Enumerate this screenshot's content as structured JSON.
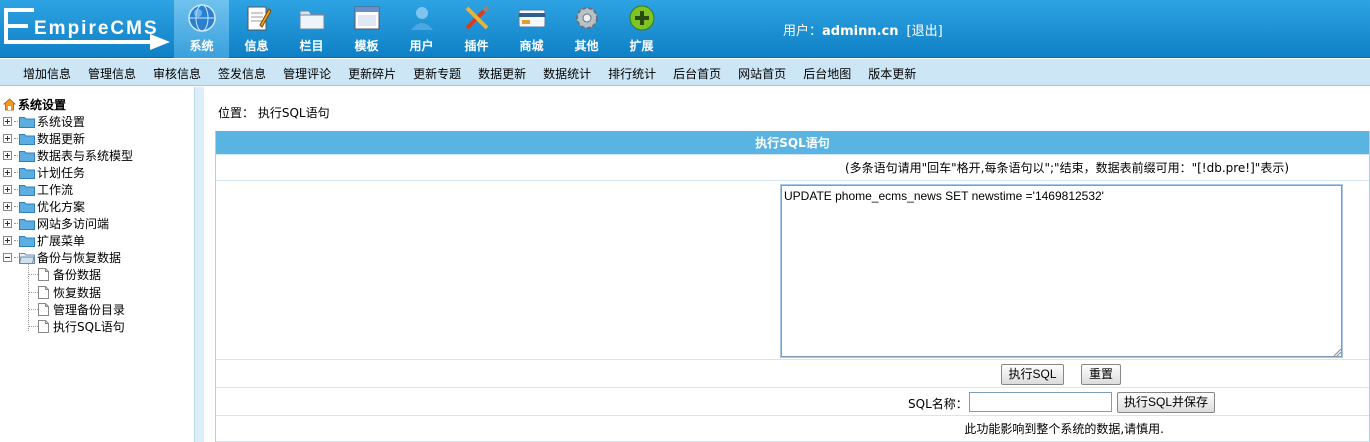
{
  "header": {
    "logo_text": "EmpireCMS",
    "nav": [
      {
        "label": "系统",
        "icon": "globe-icon",
        "active": true
      },
      {
        "label": "信息",
        "icon": "notepad-icon",
        "active": false
      },
      {
        "label": "栏目",
        "icon": "folder-icon",
        "active": false
      },
      {
        "label": "模板",
        "icon": "window-icon",
        "active": false
      },
      {
        "label": "用户",
        "icon": "user-icon",
        "active": false
      },
      {
        "label": "插件",
        "icon": "tools-icon",
        "active": false
      },
      {
        "label": "商城",
        "icon": "card-icon",
        "active": false
      },
      {
        "label": "其他",
        "icon": "gear-icon",
        "active": false
      },
      {
        "label": "扩展",
        "icon": "plus-circle-icon",
        "active": false
      }
    ],
    "user_prefix": "用户：",
    "username": "adminn.cn",
    "logout": "[退出]"
  },
  "submenu": [
    "增加信息",
    "管理信息",
    "审核信息",
    "签发信息",
    "管理评论",
    "更新碎片",
    "更新专题",
    "数据更新",
    "数据统计",
    "排行统计",
    "后台首页",
    "网站首页",
    "后台地图",
    "版本更新"
  ],
  "tree": {
    "root": "系统设置",
    "nodes": [
      "系统设置",
      "数据更新",
      "数据表与系统模型",
      "计划任务",
      "工作流",
      "优化方案",
      "网站多访问端",
      "扩展菜单",
      "备份与恢复数据"
    ],
    "children": [
      "备份数据",
      "恢复数据",
      "管理备份目录",
      "执行SQL语句"
    ]
  },
  "breadcrumb": {
    "prefix": "位置：",
    "current": "执行SQL语句"
  },
  "panel": {
    "title": "执行SQL语句",
    "note": "(多条语句请用\"回车\"格开,每条语句以\";\"结束，数据表前缀可用：\"[!db.pre!]\"表示)",
    "sql_value": "UPDATE phome_ecms_news SET newstime ='1469812532'",
    "exec_button": "执行SQL",
    "reset_button": "重置",
    "sqlname_label": "SQL名称：",
    "sqlname_value": "",
    "save_button": "执行SQL并保存",
    "warning": "此功能影响到整个系统的数据,请慎用."
  },
  "colors": {
    "header_blue": "#1a8ed3",
    "submenu_bg": "#cde6f5",
    "panel_head": "#5ab4e2"
  }
}
